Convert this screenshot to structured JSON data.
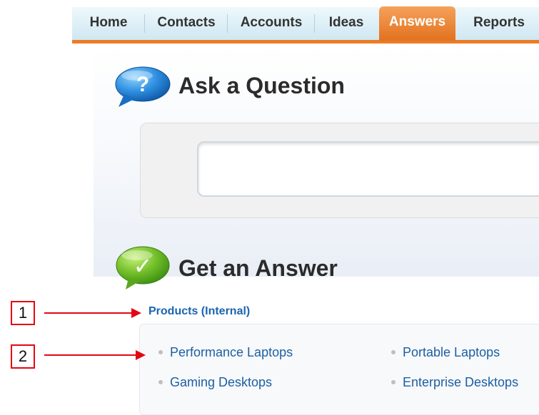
{
  "nav": {
    "tabs": [
      {
        "label": "Home",
        "active": false
      },
      {
        "label": "Contacts",
        "active": false
      },
      {
        "label": "Accounts",
        "active": false
      },
      {
        "label": "Ideas",
        "active": false
      },
      {
        "label": "Answers",
        "active": true
      },
      {
        "label": "Reports",
        "active": false
      }
    ]
  },
  "ask": {
    "icon_glyph": "?",
    "heading": "Ask a Question",
    "search_value": ""
  },
  "answer": {
    "icon_glyph": "✓",
    "heading": "Get an Answer",
    "category": "Products (Internal)",
    "subcategories": [
      "Performance Laptops",
      "Portable Laptops",
      "Gaming Desktops",
      "Enterprise Desktops"
    ]
  },
  "callouts": [
    "1",
    "2"
  ],
  "colors": {
    "accent_orange": "#ec7c24",
    "link_blue": "#1b64b0",
    "callout_red": "#e30613"
  }
}
